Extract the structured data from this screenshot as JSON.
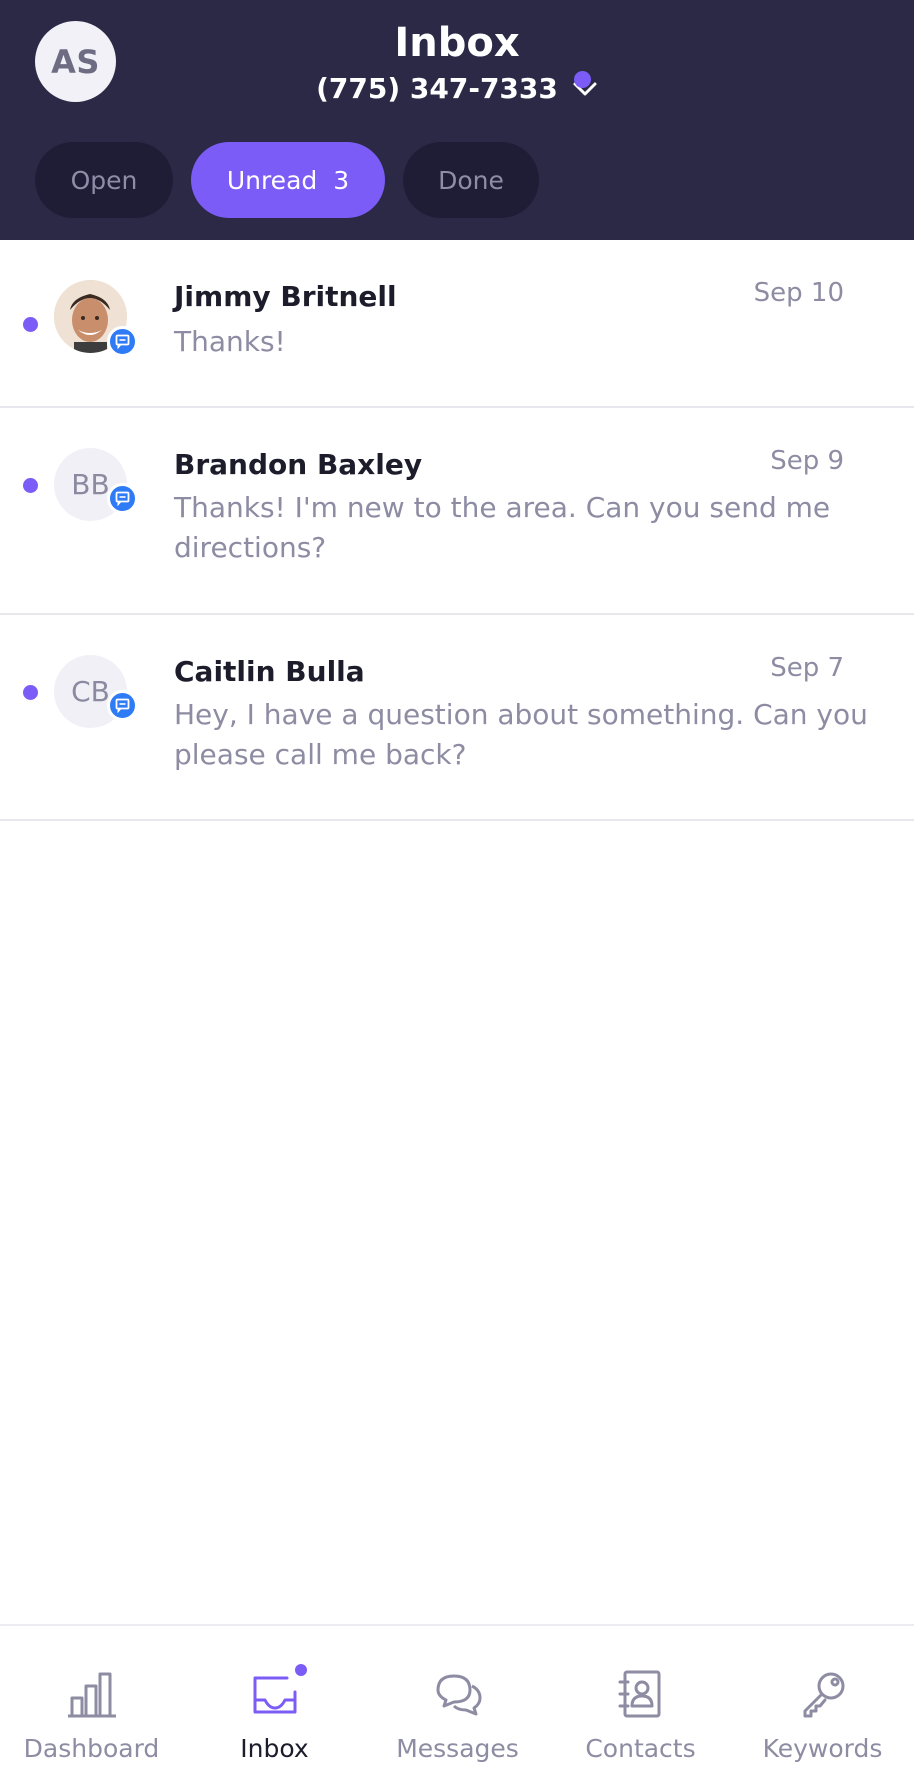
{
  "header": {
    "avatar_initials": "AS",
    "title": "Inbox",
    "phone_number": "(775) 347-7333",
    "accent_color": "#7c5cf6",
    "background_color": "#2b2946"
  },
  "tabs": [
    {
      "label": "Open"
    },
    {
      "label": "Unread",
      "count": "3",
      "active": true
    },
    {
      "label": "Done"
    }
  ],
  "conversations": [
    {
      "name": "Jimmy Britnell",
      "date": "Sep 10",
      "preview": "Thanks!",
      "avatar": "photo",
      "unread": true,
      "channel_icon": "chat-icon"
    },
    {
      "name": "Brandon Baxley",
      "date": "Sep 9",
      "preview": "Thanks! I'm new to the area. Can you send me directions?",
      "initials": "BB",
      "unread": true,
      "channel_icon": "chat-icon"
    },
    {
      "name": "Caitlin Bulla",
      "date": "Sep 7",
      "preview": "Hey, I have a question about something. Can you please call me back?",
      "initials": "CB",
      "unread": true,
      "channel_icon": "chat-icon"
    }
  ],
  "nav": [
    {
      "label": "Dashboard",
      "icon": "bar-chart-icon"
    },
    {
      "label": "Inbox",
      "icon": "inbox-icon",
      "active": true
    },
    {
      "label": "Messages",
      "icon": "chat-bubbles-icon"
    },
    {
      "label": "Contacts",
      "icon": "contact-book-icon"
    },
    {
      "label": "Keywords",
      "icon": "key-icon"
    }
  ]
}
